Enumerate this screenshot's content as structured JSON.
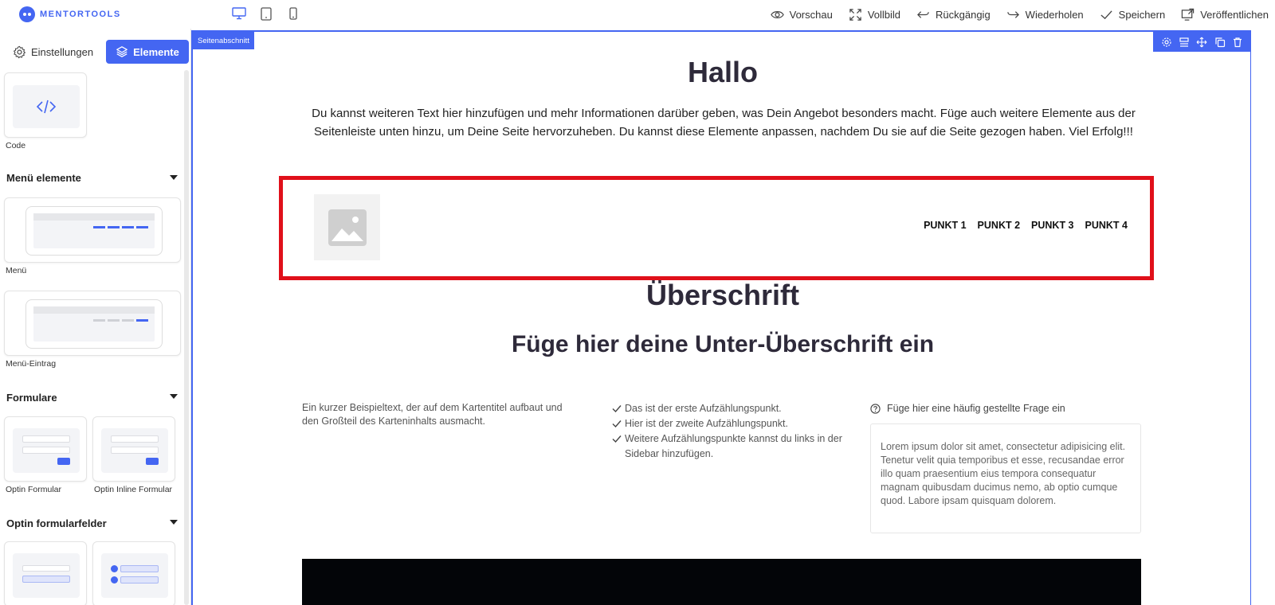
{
  "brand": {
    "name": "MENTORTOOLS",
    "accent": "#4466f2"
  },
  "devices": [
    "desktop-icon",
    "tablet-icon",
    "mobile-icon"
  ],
  "toolbar": {
    "preview": "Vorschau",
    "fullscreen": "Vollbild",
    "undo": "Rückgängig",
    "redo": "Wiederholen",
    "save": "Speichern",
    "publish": "Veröffentlichen"
  },
  "sidebar": {
    "tab_settings": "Einstellungen",
    "tab_elements": "Elemente",
    "code_label": "Code",
    "menu_section": "Menü elemente",
    "menu_label": "Menü",
    "menu_entry_label": "Menü-Eintrag",
    "forms_section": "Formulare",
    "optin_form": "Optin Formular",
    "optin_inline_form": "Optin Inline Formular",
    "optin_fields_section": "Optin formularfelder"
  },
  "canvas": {
    "section_tag": "Seitenabschnitt",
    "title": "Hallo",
    "intro": "Du kannst weiteren Text hier hinzufügen und mehr Informationen darüber geben, was Dein Angebot besonders macht. Füge auch weitere Elemente aus der Seitenleiste unten hinzu, um Deine Seite hervorzuheben. Du kannst diese Elemente anpassen, nachdem Du sie auf die Seite gezogen haben. Viel Erfolg!!!",
    "menu_items": [
      "PUNKT 1",
      "PUNKT 2",
      "PUNKT 3",
      "PUNKT 4"
    ],
    "heading": "Überschrift",
    "subheading": "Füge hier deine Unter-Überschrift ein",
    "card_text": "Ein kurzer Beispieltext, der auf dem Kartentitel aufbaut und den Großteil des Karteninhalts ausmacht.",
    "bullets": [
      "Das ist der erste Aufzählungspunkt.",
      "Hier ist der zweite Aufzählungspunkt.",
      "Weitere Aufzählungspunkte kannst du links in der Sidebar hinzufügen."
    ],
    "faq_question": "Füge hier eine häufig gestellte Frage ein",
    "faq_answer": "Lorem ipsum dolor sit amet, consectetur adipisicing elit. Tenetur velit quia temporibus et esse, recusandae error illo quam praesentium eius tempora consequatur magnam quibusdam ducimus nemo, ab optio cumque quod. Labore ipsam quisquam dolorem.",
    "highlight_color": "#e0101a"
  }
}
